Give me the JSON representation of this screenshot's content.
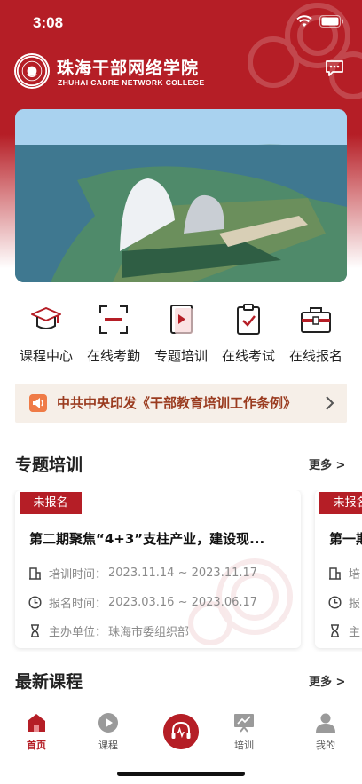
{
  "status_bar": {
    "time": "3:08"
  },
  "header": {
    "title_cn": "珠海干部网络学院",
    "title_en": "ZHUHAI CADRE NETWORK COLLEGE"
  },
  "quick_nav": [
    {
      "label": "课程中心",
      "icon": "graduation-cap-icon"
    },
    {
      "label": "在线考勤",
      "icon": "scan-frame-icon"
    },
    {
      "label": "专题培训",
      "icon": "play-book-icon"
    },
    {
      "label": "在线考试",
      "icon": "clipboard-check-icon"
    },
    {
      "label": "在线报名",
      "icon": "briefcase-icon"
    }
  ],
  "notice": {
    "text": "中共中央印发《干部教育培训工作条例》"
  },
  "special_training": {
    "title": "专题培训",
    "more": "更多 >",
    "cards": [
      {
        "badge": "未报名",
        "title": "第二期聚焦“4+3”支柱产业，建设现...",
        "training_label": "培训时间：",
        "training_time": "2023.11.14 ~ 2023.11.17",
        "signup_label": "报名时间：",
        "signup_time": "2023.03.16 ~ 2023.06.17",
        "host_label": "主办单位：",
        "host": "珠海市委组织部"
      },
      {
        "badge": "未报名",
        "title": "第一期",
        "training_label": "培",
        "signup_label": "报",
        "host_label": "主"
      }
    ]
  },
  "latest_courses": {
    "title": "最新课程",
    "more": "更多 >"
  },
  "tabbar": [
    {
      "label": "首页",
      "icon": "home-icon",
      "active": true
    },
    {
      "label": "课程",
      "icon": "play-circle-icon"
    },
    {
      "label": "",
      "icon": "headphones-icon"
    },
    {
      "label": "培训",
      "icon": "presentation-icon"
    },
    {
      "label": "我的",
      "icon": "user-icon"
    }
  ],
  "colors": {
    "brand_red": "#b51e26",
    "notice_bg": "#f6efe8",
    "notice_text": "#9a3b1f"
  }
}
